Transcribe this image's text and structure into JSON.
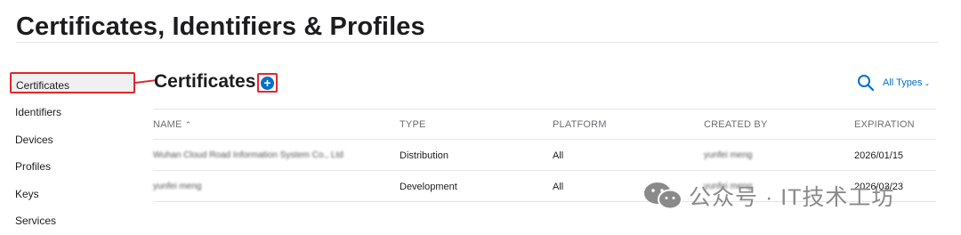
{
  "page_title": "Certificates, Identifiers & Profiles",
  "sidebar": {
    "items": [
      {
        "label": "Certificates"
      },
      {
        "label": "Identifiers"
      },
      {
        "label": "Devices"
      },
      {
        "label": "Profiles"
      },
      {
        "label": "Keys"
      },
      {
        "label": "Services"
      }
    ]
  },
  "main": {
    "section_title": "Certificates",
    "add_icon": "plus-circle-icon",
    "search_icon": "search-icon",
    "filter_label": "All Types",
    "columns": [
      "NAME",
      "TYPE",
      "PLATFORM",
      "CREATED BY",
      "EXPIRATION"
    ],
    "sort_indicator": "⌃",
    "rows": [
      {
        "name": "Wuhan Cloud Road Information System Co., Ltd",
        "type": "Distribution",
        "platform": "All",
        "created_by": "yunfei meng",
        "expiration": "2026/01/15"
      },
      {
        "name": "yunfei meng",
        "type": "Development",
        "platform": "All",
        "created_by": "yunfei meng",
        "expiration": "2026/03/23"
      }
    ]
  },
  "watermark": {
    "text": "公众号 · IT技术工坊",
    "icon": "wechat-icon"
  },
  "colors": {
    "accent": "#0070c9",
    "highlight": "#e2262b"
  }
}
